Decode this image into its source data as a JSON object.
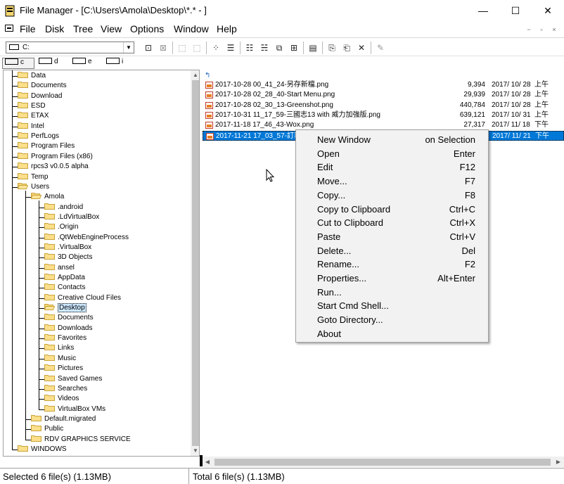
{
  "window": {
    "title": "File Manager - [C:\\Users\\Amola\\Desktop\\*.* - ]",
    "controls": {
      "minimize": "—",
      "maximize": "☐",
      "close": "✕"
    }
  },
  "menubar": {
    "items": [
      "File",
      "Disk",
      "Tree",
      "View",
      "Options",
      "Window",
      "Help"
    ],
    "mdi_controls": [
      "−",
      "▫",
      "×"
    ]
  },
  "toolbar": {
    "drive_selected": "C:",
    "buttons": [
      "connect-drive-icon",
      "disconnect-drive-icon",
      "share-icon",
      "stop-share-icon",
      "large-icons-icon",
      "small-icons-icon",
      "sort-by-name-icon",
      "sort-by-type-icon",
      "tree-only-icon",
      "details-icon",
      "new-window-icon",
      "copy-icon",
      "move-icon",
      "delete-icon",
      "properties-icon"
    ]
  },
  "drives": [
    {
      "letter": "c",
      "active": true
    },
    {
      "letter": "d",
      "active": false
    },
    {
      "letter": "e",
      "active": false
    },
    {
      "letter": "i",
      "active": false
    }
  ],
  "tree": [
    {
      "label": "Data",
      "level": 1
    },
    {
      "label": "Documents",
      "level": 1
    },
    {
      "label": "Download",
      "level": 1
    },
    {
      "label": "ESD",
      "level": 1
    },
    {
      "label": "ETAX",
      "level": 1
    },
    {
      "label": "Intel",
      "level": 1
    },
    {
      "label": "PerfLogs",
      "level": 1
    },
    {
      "label": "Program Files",
      "level": 1
    },
    {
      "label": "Program Files (x86)",
      "level": 1
    },
    {
      "label": "rpcs3 v0.0.5 alpha",
      "level": 1
    },
    {
      "label": "Temp",
      "level": 1
    },
    {
      "label": "Users",
      "level": 1,
      "open": true
    },
    {
      "label": "Amola",
      "level": 2,
      "open": true
    },
    {
      "label": ".android",
      "level": 3
    },
    {
      "label": ".LdVirtualBox",
      "level": 3
    },
    {
      "label": ".Origin",
      "level": 3
    },
    {
      "label": ".QtWebEngineProcess",
      "level": 3
    },
    {
      "label": ".VirtualBox",
      "level": 3
    },
    {
      "label": "3D Objects",
      "level": 3
    },
    {
      "label": "ansel",
      "level": 3
    },
    {
      "label": "AppData",
      "level": 3
    },
    {
      "label": "Contacts",
      "level": 3
    },
    {
      "label": "Creative Cloud Files",
      "level": 3
    },
    {
      "label": "Desktop",
      "level": 3,
      "selected": true,
      "open": true
    },
    {
      "label": "Documents",
      "level": 3
    },
    {
      "label": "Downloads",
      "level": 3
    },
    {
      "label": "Favorites",
      "level": 3
    },
    {
      "label": "Links",
      "level": 3
    },
    {
      "label": "Music",
      "level": 3
    },
    {
      "label": "Pictures",
      "level": 3
    },
    {
      "label": "Saved Games",
      "level": 3
    },
    {
      "label": "Searches",
      "level": 3
    },
    {
      "label": "Videos",
      "level": 3
    },
    {
      "label": "VirtualBox VMs",
      "level": 3
    },
    {
      "label": "Default.migrated",
      "level": 2
    },
    {
      "label": "Public",
      "level": 2
    },
    {
      "label": "RDV GRAPHICS SERVICE",
      "level": 2
    },
    {
      "label": "WINDOWS",
      "level": 1
    }
  ],
  "files": [
    {
      "name": "2017-10-28 00_41_24-另存新檔.png",
      "size": "9,394",
      "date": "2017/ 10/ 28",
      "time": "上午",
      "selected": false
    },
    {
      "name": "2017-10-28 02_28_40-Start Menu.png",
      "size": "29,939",
      "date": "2017/ 10/ 28",
      "time": "上午",
      "selected": false
    },
    {
      "name": "2017-10-28 02_30_13-Greenshot.png",
      "size": "440,784",
      "date": "2017/ 10/ 28",
      "time": "上午",
      "selected": false
    },
    {
      "name": "2017-10-31 11_17_59-三國志13 with 威力加強版.png",
      "size": "639,121",
      "date": "2017/ 10/ 31",
      "time": "上午",
      "selected": false
    },
    {
      "name": "2017-11-18 17_46_43-Wox.png",
      "size": "27,317",
      "date": "2017/ 11/ 18",
      "time": "下午",
      "selected": false
    },
    {
      "name": "2017-11-21 17_03_57-訂單",
      "size": "",
      "date": "2017/ 11/ 21",
      "time": "下午",
      "selected": true
    }
  ],
  "up_icon": "↰",
  "context_menu": [
    {
      "label": "New Window",
      "key": "on Selection"
    },
    {
      "label": "Open",
      "key": "Enter"
    },
    {
      "label": "Edit",
      "key": "F12"
    },
    {
      "label": "Move...",
      "key": "F7"
    },
    {
      "label": "Copy...",
      "key": "F8"
    },
    {
      "label": "Copy to Clipboard",
      "key": "Ctrl+C"
    },
    {
      "label": "Cut to Clipboard",
      "key": "Ctrl+X"
    },
    {
      "label": "Paste",
      "key": "Ctrl+V"
    },
    {
      "label": "Delete...",
      "key": "Del"
    },
    {
      "label": "Rename...",
      "key": "F2"
    },
    {
      "label": "Properties...",
      "key": "Alt+Enter"
    },
    {
      "label": "Run...",
      "key": ""
    },
    {
      "label": "Start Cmd Shell...",
      "key": ""
    },
    {
      "label": "Goto Directory...",
      "key": ""
    },
    {
      "label": "About",
      "key": ""
    }
  ],
  "status": {
    "left": "Selected 6 file(s) (1.13MB)",
    "right": "Total 6 file(s) (1.13MB)"
  }
}
